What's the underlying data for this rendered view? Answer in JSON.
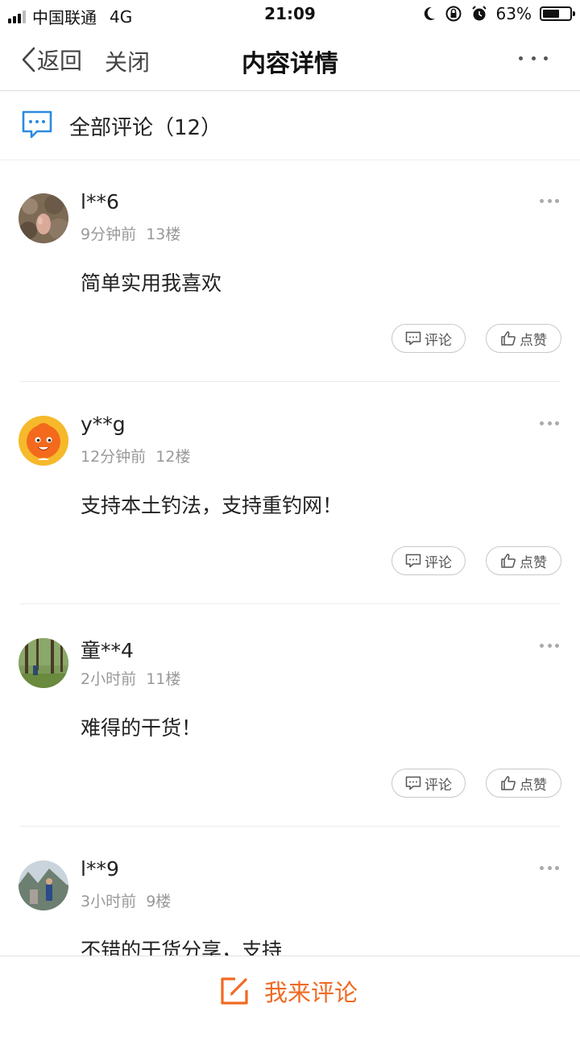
{
  "status_bar": {
    "carrier": "中国联通",
    "network": "4G",
    "time": "21:09",
    "battery": "63%",
    "battery_level": 0.63,
    "icons": [
      "moon-icon",
      "rotation-lock-icon",
      "alarm-icon",
      "battery-icon"
    ]
  },
  "nav": {
    "back_label": "返回",
    "close_label": "关闭",
    "title": "内容详情",
    "more_icon": "more-dots-icon"
  },
  "section": {
    "title": "全部评论（12）",
    "icon": "comment-bubble-icon",
    "accent_color": "#2b8ae0"
  },
  "comments": [
    {
      "username": "l**6",
      "time": "9分钟前",
      "floor": "13楼",
      "text": "简单实用我喜欢",
      "avatar": "rock-photo-avatar"
    },
    {
      "username": "y**g",
      "time": "12分钟前",
      "floor": "12楼",
      "text": "支持本土钓法，支持重钓网！",
      "avatar": "orange-cartoon-avatar"
    },
    {
      "username": "童**4",
      "time": "2小时前",
      "floor": "11楼",
      "text": "难得的干货！",
      "avatar": "forest-photo-avatar"
    },
    {
      "username": "l**9",
      "time": "3小时前",
      "floor": "9楼",
      "text": "不错的干货分享，支持",
      "avatar": "outdoor-photo-avatar"
    }
  ],
  "actions": {
    "reply_label": "评论",
    "like_label": "点赞"
  },
  "bottom": {
    "write_label": "我来评论",
    "accent_color": "#f06a23"
  }
}
